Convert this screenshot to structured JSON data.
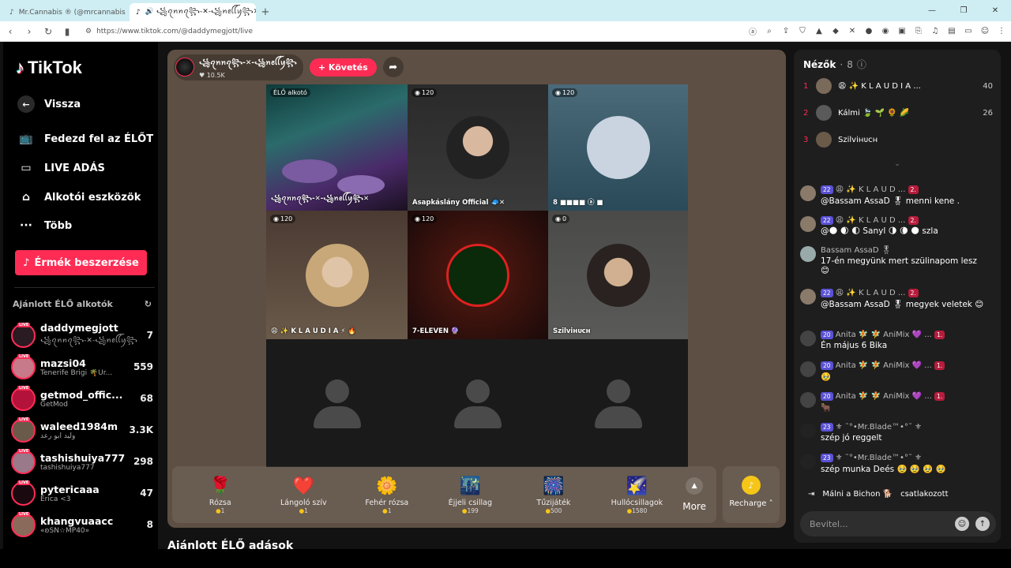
{
  "browser": {
    "tabs": [
      {
        "label": "Mr.Cannabis ® (@mrcannabis"
      },
      {
        "label": "🔊 ꧁ꪖꪀꪀꪖ꧂-✕-꧁ꪀꫀꪶꪶꪗ꧂✕ (@da"
      }
    ],
    "new_tab": "+",
    "url": "https://www.tiktok.com/@daddymegjott/live"
  },
  "sidebar": {
    "logo": "TikTok",
    "back": "Vissza",
    "nav": [
      {
        "label": "Fedezd fel az ÉLŐT"
      },
      {
        "label": "LIVE ADÁS"
      },
      {
        "label": "Alkotói eszközök"
      },
      {
        "label": "Több"
      }
    ],
    "coins_button": "Érmék beszerzése",
    "recommended_title": "Ajánlott ÉLŐ alkotók",
    "creators": [
      {
        "name": "daddymegjott",
        "sub": "꧁ꪖꪀꪀꪖ꧂-✕-꧁ꪀꫀꪶꪶꪗ꧂",
        "count": "7"
      },
      {
        "name": "mazsi04",
        "sub": "Tenerife Brigi 🌴Úr...",
        "count": "559"
      },
      {
        "name": "getmod_offic...",
        "sub": "GetMod",
        "count": "68"
      },
      {
        "name": "waleed1984m",
        "sub": "وليد ابو رعد",
        "count": "3.3K"
      },
      {
        "name": "tashishuiya777",
        "sub": "tashishuiya777",
        "count": "298"
      },
      {
        "name": "pytericaaa",
        "sub": "Erica <3",
        "count": "47"
      },
      {
        "name": "khangvuaacc",
        "sub": "«ʚSN☆MP40»",
        "count": "8"
      }
    ],
    "live_badge": "LIVE"
  },
  "main": {
    "host_name": "꧁ꪖꪀꪀꪖ꧂-✕-꧁ꪀꫀꪶꪶꪗ꧂",
    "host_likes": "10.5K",
    "follow": "+ Követés",
    "cells": [
      {
        "badge": "ÉLŐ alkotó",
        "label": "꧁ꪖꪀꪀꪖ꧂-✕-꧁ꪀꫀꪶꪶꪗ꧂✕"
      },
      {
        "badge": "120",
        "label": "Asapkáslány Official 🧢✕"
      },
      {
        "badge": "120",
        "label": "8 ■■■■ ⓐ ■"
      },
      {
        "badge": "120",
        "label": "😩 ✨ K L A U D I A ⚡ 🔥"
      },
      {
        "badge": "120",
        "label": "7-ELEVEN 🔮"
      },
      {
        "badge": "0",
        "label": "Szilviʜᴜᴄʜ"
      }
    ],
    "gifts": [
      {
        "icon": "🌹",
        "name": "Rózsa",
        "price": "1"
      },
      {
        "icon": "❤️",
        "name": "Lángoló szív",
        "price": "1"
      },
      {
        "icon": "🌼",
        "name": "Fehér rózsa",
        "price": "1"
      },
      {
        "icon": "🌃",
        "name": "Éjjeli csillag",
        "price": "199"
      },
      {
        "icon": "🎆",
        "name": "Tűzijáték",
        "price": "500"
      },
      {
        "icon": "🌠",
        "name": "Hullócsillagok",
        "price": "1580"
      }
    ],
    "more": "More",
    "recharge": "Recharge"
  },
  "below_title": "Ajánlott ÉLŐ adások",
  "viewers": {
    "title": "Nézők",
    "count": "8",
    "list": [
      {
        "rank": "1",
        "name": "😩 ✨ K L A U D I A ...",
        "score": "40"
      },
      {
        "rank": "2",
        "name": "Kálmi 🍃 🌱 🌻 🌽",
        "score": "26"
      },
      {
        "rank": "3",
        "name": "Szilviʜᴜᴄʜ",
        "score": "4"
      }
    ]
  },
  "chat": [
    {
      "head": "😩 ✨ K L A U D ...",
      "lvl": "22",
      "rank": "2.",
      "body": "@Bassam AssaD 🎖 menni kene ."
    },
    {
      "head": "😩 ✨ K L A U D ...",
      "lvl": "22",
      "rank": "2.",
      "body": "@🌑 🌒 🌓 Sanyl 🌗 🌘 🌑 szla"
    },
    {
      "head": "Bassam AssaD 🎖",
      "lvl": "",
      "rank": "",
      "body": "17-én megyünk mert szülinapom lesz 😊"
    },
    {
      "head": "😩 ✨ K L A U D ...",
      "lvl": "22",
      "rank": "2.",
      "body": "@Bassam AssaD 🎖 megyek veletek 😊"
    },
    {
      "head": "Anita 🧚 🧚 AniMix 💜 ...",
      "lvl": "20",
      "rank": "1.",
      "body": "Én május 6 Bika"
    },
    {
      "head": "Anita 🧚 🧚 AniMix 💜 ...",
      "lvl": "20",
      "rank": "1.",
      "body": "🥹"
    },
    {
      "head": "Anita 🧚 🧚 AniMix 💜 ...",
      "lvl": "20",
      "rank": "1.",
      "body": "🐂"
    },
    {
      "head": "⚜ ˜°•Mr.Blade™•°˜ ⚜",
      "lvl": "23",
      "rank": "",
      "body": "szép jó reggelt"
    },
    {
      "head": "⚜ ˜°•Mr.Blade™•°˜ ⚜",
      "lvl": "23",
      "rank": "",
      "body": "szép munka Deés 🥹 🥹 🥹 🥹"
    }
  ],
  "joined": {
    "name": "Málni a Bichon 🐕",
    "text": "csatlakozott"
  },
  "input_placeholder": "Bevitel..."
}
